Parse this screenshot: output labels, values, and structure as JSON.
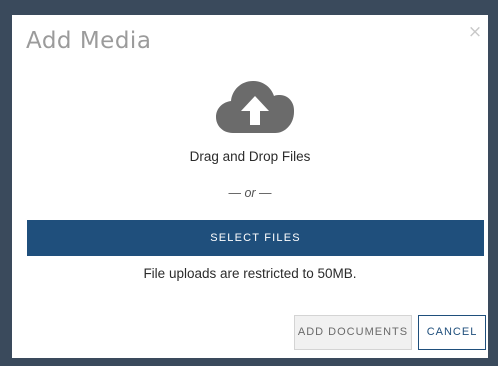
{
  "modal": {
    "title": "Add Media",
    "close_label": "×",
    "upload_icon": "cloud-upload-icon",
    "drag_text": "Drag and Drop Files",
    "or_text": "— or —",
    "select_files_label": "SELECT FILES",
    "restriction_text": "File uploads are restricted to 50MB.",
    "add_documents_label": "ADD DOCUMENTS",
    "cancel_label": "CANCEL"
  },
  "colors": {
    "primary": "#1f4f7c",
    "backdrop": "#3a4a5c",
    "icon": "#6b6b6b"
  }
}
